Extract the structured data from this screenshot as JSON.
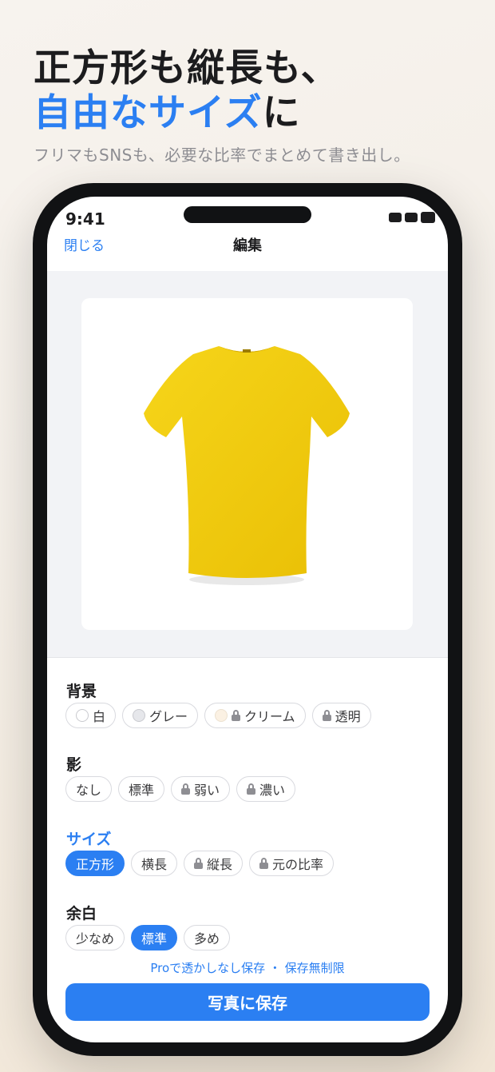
{
  "promo": {
    "headline_line1": "正方形も縦長も、",
    "headline_line2_accent": "自由なサイズ",
    "headline_line2_tail": "に",
    "subtitle": "フリマもSNSも、必要な比率でまとめて書き出し。"
  },
  "status_bar": {
    "time": "9:41"
  },
  "nav": {
    "close_label": "閉じる",
    "title": "編集"
  },
  "sections": {
    "background": {
      "label": "背景",
      "options": [
        {
          "label": "白",
          "swatch": "#ffffff",
          "locked": false,
          "selected": false
        },
        {
          "label": "グレー",
          "swatch": "#e6e7eb",
          "locked": false,
          "selected": false
        },
        {
          "label": "クリーム",
          "swatch": "#fbf1e3",
          "locked": true,
          "selected": false
        },
        {
          "label": "透明",
          "locked": true,
          "selected": false
        }
      ]
    },
    "shadow": {
      "label": "影",
      "options": [
        {
          "label": "なし",
          "locked": false,
          "selected": false
        },
        {
          "label": "標準",
          "locked": false,
          "selected": false
        },
        {
          "label": "弱い",
          "locked": true,
          "selected": false
        },
        {
          "label": "濃い",
          "locked": true,
          "selected": false
        }
      ]
    },
    "size": {
      "label": "サイズ",
      "options": [
        {
          "label": "正方形",
          "locked": false,
          "selected": true
        },
        {
          "label": "横長",
          "locked": false,
          "selected": false
        },
        {
          "label": "縦長",
          "locked": true,
          "selected": false
        },
        {
          "label": "元の比率",
          "locked": true,
          "selected": false
        }
      ]
    },
    "margin": {
      "label": "余白",
      "options": [
        {
          "label": "少なめ",
          "locked": false,
          "selected": false
        },
        {
          "label": "標準",
          "locked": false,
          "selected": true
        },
        {
          "label": "多め",
          "locked": false,
          "selected": false
        }
      ]
    }
  },
  "pro_note": "Proで透かしなし保存 ・ 保存無制限",
  "save_button": "写真に保存",
  "colors": {
    "accent": "#2b7ff2",
    "tshirt": "#f2cc12"
  }
}
